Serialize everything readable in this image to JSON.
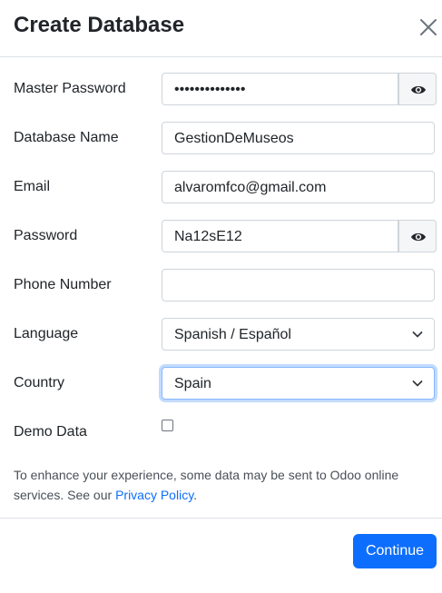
{
  "dialog": {
    "title": "Create Database",
    "close_icon": "close-icon"
  },
  "form": {
    "master_password": {
      "label": "Master Password",
      "value": "••••••••••••••"
    },
    "database_name": {
      "label": "Database Name",
      "value": "GestionDeMuseos"
    },
    "email": {
      "label": "Email",
      "value": "alvaromfco@gmail.com"
    },
    "password": {
      "label": "Password",
      "value": "Na12sE12"
    },
    "phone_number": {
      "label": "Phone Number",
      "value": ""
    },
    "language": {
      "label": "Language",
      "value": "Spanish / Español"
    },
    "country": {
      "label": "Country",
      "value": "Spain"
    },
    "demo_data": {
      "label": "Demo Data",
      "checked": false
    }
  },
  "notice": {
    "text": "To enhance your experience, some data may be sent to Odoo online services. See our ",
    "link": "Privacy Policy",
    "end": "."
  },
  "footer": {
    "continue_label": "Continue"
  },
  "colors": {
    "primary": "#0d6efd",
    "border": "#ced4da",
    "focus": "#86b7fe"
  }
}
